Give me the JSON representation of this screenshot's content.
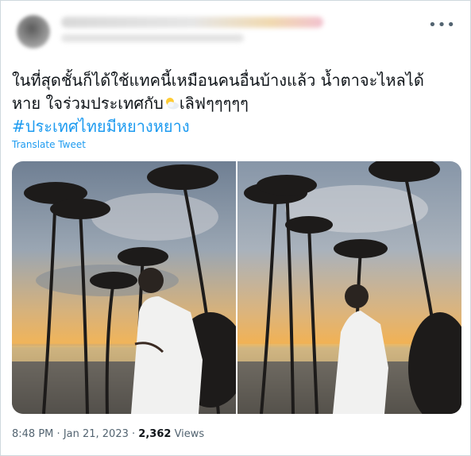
{
  "tweet": {
    "more_icon": "more-horizontal-icon",
    "text_line1": "ในที่สุดชั้นก็ได้ใช้แทคนี้เหมือนคนอื่นบ้างแล้ว น้ำตาจะไหลได้",
    "text_line2_before_emoji": "หาย ใจร่วมประเทศกับ",
    "emoji_icon": "sun-behind-cloud-icon",
    "text_line2_after_emoji": "เลิฟๆๆๆๆๆ",
    "hashtag": "#ประเทศไทยมีหยางหยาง",
    "translate_label": "Translate Tweet",
    "time": "8:48 PM",
    "separator": "·",
    "date": "Jan 21, 2023",
    "views_count": "2,362",
    "views_label": "Views",
    "accent_color": "#1d9bf0"
  }
}
